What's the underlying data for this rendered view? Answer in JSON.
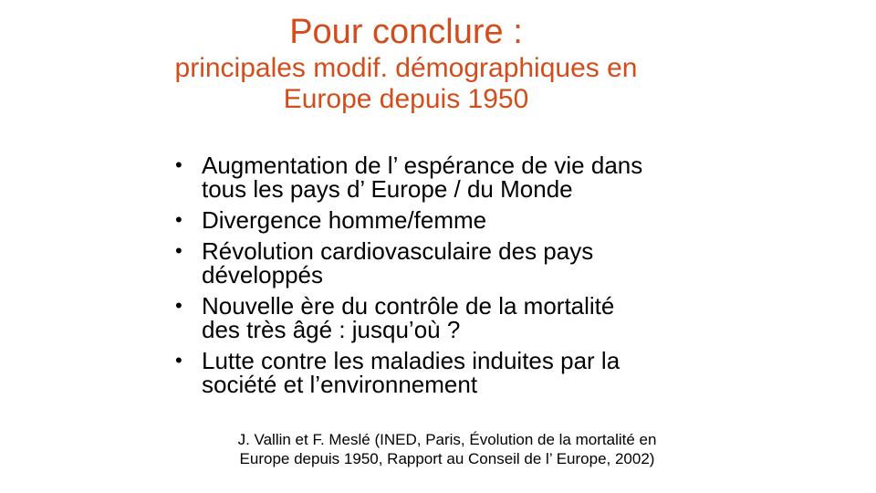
{
  "colors": {
    "title": "#d24d1b",
    "text": "#000000",
    "background": "#ffffff"
  },
  "title": {
    "main": "Pour conclure :",
    "sub_line1": "principales modif. démographiques en",
    "sub_line2": "Europe depuis 1950"
  },
  "bullet_glyph": "•",
  "bullets": [
    {
      "line1": "Augmentation de l’ espérance de vie dans",
      "line2": "tous les pays d’ Europe / du Monde"
    },
    {
      "line1": "Divergence homme/femme"
    },
    {
      "line1": "Révolution cardiovasculaire des pays",
      "line2": "développés"
    },
    {
      "line1": "Nouvelle ère du contrôle de la mortalité",
      "line2": "des très âgé : jusqu’où ?"
    },
    {
      "line1": "Lutte contre les maladies induites par la",
      "line2": "société et l’environnement"
    }
  ],
  "citation": {
    "line1": "J. Vallin et F. Meslé (INED, Paris, Évolution de la mortalité en",
    "line2": "Europe depuis 1950, Rapport au Conseil de l’ Europe, 2002)"
  }
}
